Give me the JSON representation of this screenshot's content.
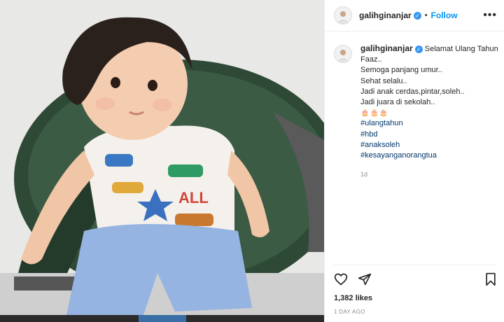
{
  "post": {
    "username": "galihginanjar",
    "follow_label": "Follow",
    "more_label": "•••",
    "dot": "•"
  },
  "caption": {
    "username": "galihginanjar",
    "first": "Selamat Ulang Tahun",
    "lines": [
      "Faaz..",
      "Semoga panjang umur..",
      "Sehat selalu..",
      "Jadi anak cerdas,pintar,soleh..",
      "Jadi juara di sekolah.."
    ],
    "emoji": "🎂🎂🎂",
    "hashtags": [
      "#ulangtahun",
      "#hbd",
      "#anaksoleh",
      "#kesayanganorangtua"
    ],
    "age": "1d"
  },
  "stats": {
    "likes": "1,382 likes",
    "time": "1 DAY AGO"
  },
  "icons": {
    "like": "heart-icon",
    "share": "send-icon",
    "save": "bookmark-icon",
    "verified": "verified-badge-icon"
  }
}
